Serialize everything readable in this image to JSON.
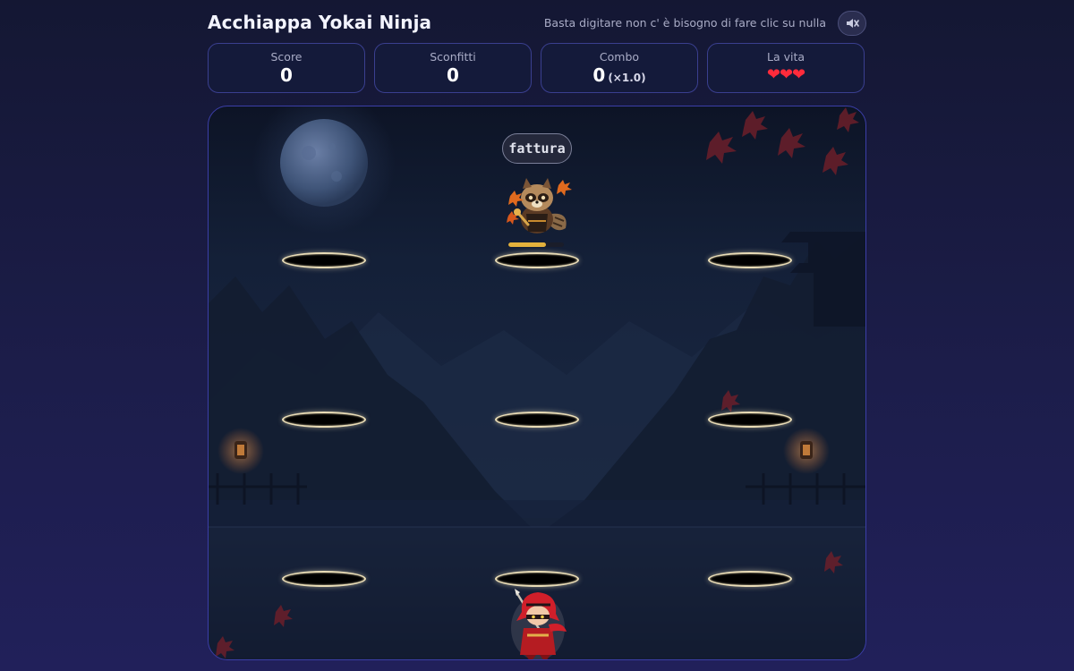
{
  "header": {
    "title": "Acchiappa Yokai Ninja",
    "hint": "Basta digitare non c' è bisogno di fare clic su nulla",
    "sound_icon": "speaker-muted-icon"
  },
  "stats": {
    "score": {
      "label": "Score",
      "value": "0"
    },
    "defeated": {
      "label": "Sconfitti",
      "value": "0"
    },
    "combo": {
      "label": "Combo",
      "value": "0",
      "multiplier": "(×1.0)"
    },
    "lives": {
      "label": "La vita",
      "hearts": "❤❤❤",
      "count": 3
    }
  },
  "arena": {
    "holes_count": 9,
    "active_yokai": {
      "word": "fattura",
      "creature": "tanuki-yokai",
      "hp_fraction": 0.68
    },
    "player": "red-ninja",
    "accent_colors": {
      "hole_rim": "#e9dcb6",
      "hp_bar": "#e3b13c",
      "heart": "#ff2b3b",
      "panel_border": "#3a3f8f"
    }
  }
}
